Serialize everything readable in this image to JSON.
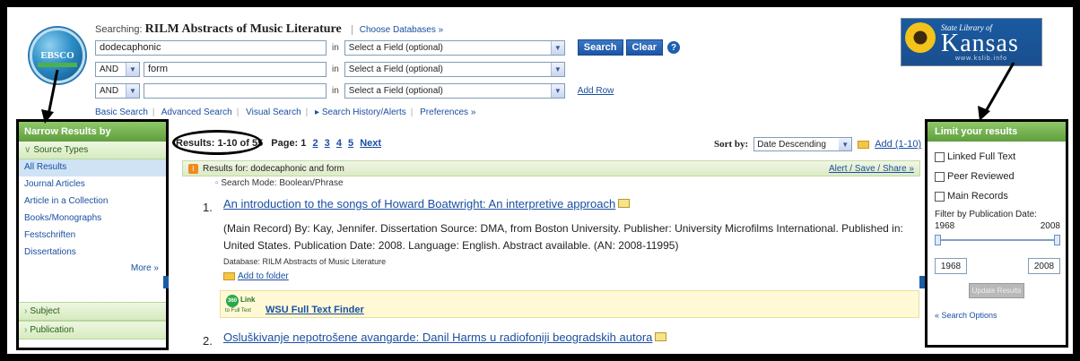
{
  "header": {
    "searching_label": "Searching:",
    "database": "RILM Abstracts of Music Literature",
    "choose_databases": "Choose Databases »",
    "rows": [
      {
        "bool": "",
        "value": "dodecaphonic",
        "field": "Select a Field (optional)"
      },
      {
        "bool": "AND",
        "value": "form",
        "field": "Select a Field (optional)"
      },
      {
        "bool": "AND",
        "value": "",
        "field": "Select a Field (optional)"
      }
    ],
    "in_label": "in",
    "search_button": "Search",
    "clear_button": "Clear",
    "add_row": "Add Row",
    "links": [
      "Basic Search",
      "Advanced Search",
      "Visual Search",
      "▸ Search History/Alerts",
      "Preferences »"
    ],
    "logo_text": "EBSCO",
    "library": {
      "small": "State Library of",
      "name": "Kansas",
      "url": "www.kslib.info"
    }
  },
  "left_panel": {
    "title": "Narrow Results by",
    "source_types": "Source Types",
    "items": [
      "All Results",
      "Journal Articles",
      "Article in a Collection",
      "Books/Monographs",
      "Festschriften",
      "Dissertations"
    ],
    "more": "More »",
    "subject": "Subject",
    "publication": "Publication"
  },
  "results_header": {
    "count": "Results: 1-10 of 55",
    "page_label": "Page: 1",
    "pages": [
      "2",
      "3",
      "4",
      "5"
    ],
    "next": "Next",
    "sort_by": "Sort by:",
    "sort_value": "Date Descending",
    "add_label": "Add (1-10)"
  },
  "results_for": {
    "label": "Results for: dodecaphonic and form",
    "alert": "Alert / Save / Share »"
  },
  "search_mode": "Search Mode: Boolean/Phrase",
  "results": [
    {
      "num": "1.",
      "title": "An introduction to the songs of Howard Boatwright: An interpretive approach",
      "desc": "(Main Record) By: Kay, Jennifer. Dissertation Source: DMA, from Boston University. Publisher: University Microfilms International. Published in: United States. Publication Date: 2008. Language: English. Abstract available. (AN: 2008-11995)",
      "database": "Database: RILM Abstracts of Music Literature",
      "add_folder": "Add to folder",
      "link_badge": "360",
      "link_label": "Link",
      "link_sub": "to Full Text",
      "full_text": "WSU Full Text Finder"
    },
    {
      "num": "2.",
      "title": "Osluškivanje nepotrošene avangarde: Danil Harms u radiofoniji beogradskih autora"
    }
  ],
  "right_panel": {
    "title": "Limit your results",
    "checkboxes": [
      "Linked Full Text",
      "Peer Reviewed",
      "Main Records"
    ],
    "filter_label": "Filter by Publication Date:",
    "year_min": "1968",
    "year_max": "2008",
    "from": "1968",
    "to": "2008",
    "update": "Update Results",
    "search_options": "« Search Options"
  }
}
